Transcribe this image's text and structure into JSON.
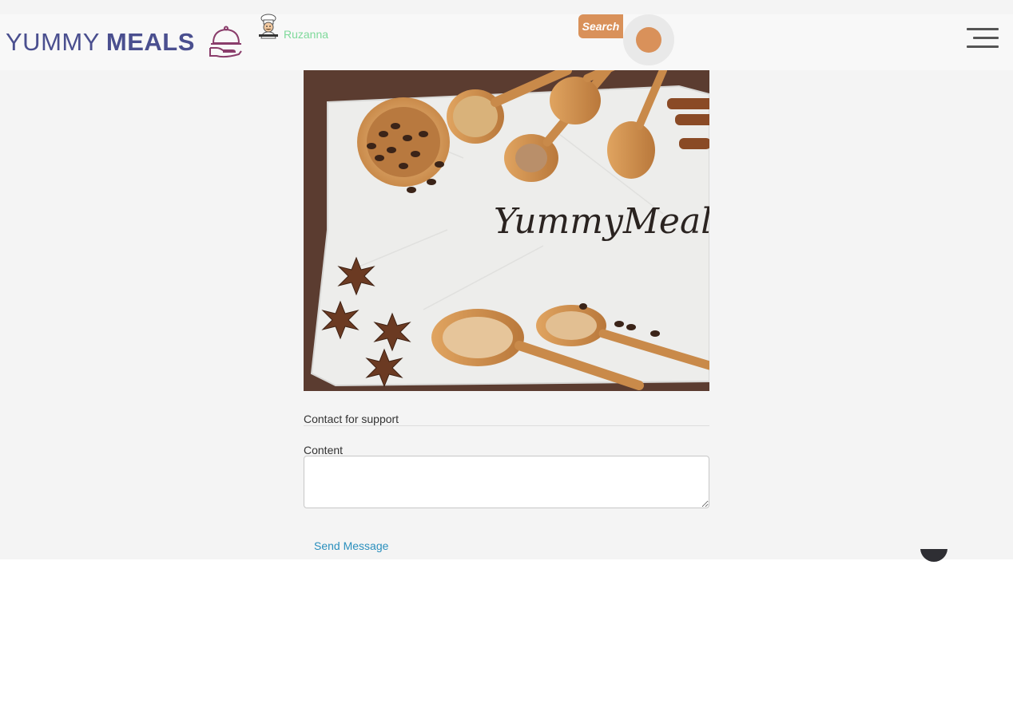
{
  "header": {
    "logo_light": "YUMMY",
    "logo_bold": "MEALS",
    "username": "Ruzanna",
    "search_label": "Search"
  },
  "hero": {
    "caption": "YummyMeals"
  },
  "form": {
    "title": "Contact for support",
    "content_label": "Content",
    "content_value": "",
    "send_label": "Send Message"
  },
  "colors": {
    "brand": "#4a4f8f",
    "accent": "#d9915a",
    "username": "#7ed99a",
    "link": "#2a8fbd"
  }
}
